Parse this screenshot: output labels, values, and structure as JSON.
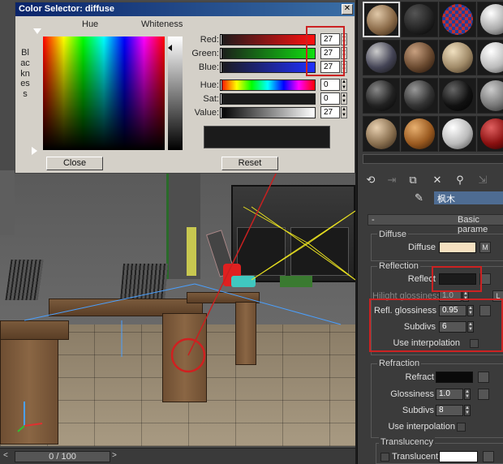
{
  "color_selector": {
    "title": "Color Selector: diffuse",
    "close_glyph": "✕",
    "hue_label": "Hue",
    "whiteness_label": "Whiteness",
    "blackness_label": "Blackness",
    "channels": [
      {
        "label": "Red:",
        "value": "27",
        "color": "#d01010"
      },
      {
        "label": "Green:",
        "value": "27",
        "color": "#10c010"
      },
      {
        "label": "Blue:",
        "value": "27",
        "color": "#2030e0"
      },
      {
        "label": "Hue:",
        "value": "0",
        "color": "rainbow"
      },
      {
        "label": "Sat:",
        "value": "0",
        "color": "#1b1b1b"
      },
      {
        "label": "Value:",
        "value": "27",
        "color": "gray"
      }
    ],
    "close_button": "Close",
    "reset_button": "Reset"
  },
  "material_editor": {
    "material_name": "枫木",
    "rollout_title": "Basic parame",
    "diffuse_group": "Diffuse",
    "diffuse_label": "Diffuse",
    "diffuse_color": "#f5e0c0",
    "map_button": "M",
    "reflection_group": "Reflection",
    "reflect_label": "Reflect",
    "reflect_color": "#1b1b1b",
    "hilight_label": "Hilight glossiness",
    "hilight_value": "1.0",
    "lock_button": "L",
    "refl_glossiness_label": "Refl. glossiness",
    "refl_glossiness_value": "0.95",
    "subdivs_label": "Subdivs",
    "subdivs_value": "6",
    "use_interpolation_label": "Use interpolation",
    "refraction_group": "Refraction",
    "refract_label": "Refract",
    "refract_color": "#0a0a0a",
    "glossiness_label": "Glossiness",
    "glossiness_value": "1.0",
    "refr_subdivs_label": "Subdivs",
    "refr_subdivs_value": "8",
    "refr_use_interpolation_label": "Use interpolation",
    "translucency_group": "Translucency",
    "translucent_label": "Translucent",
    "translucent_color": "#ffffff",
    "collapse_glyph": "-"
  },
  "timeline": {
    "frame_label": "0 / 100",
    "prev_glyph": "<",
    "next_glyph": ">"
  }
}
